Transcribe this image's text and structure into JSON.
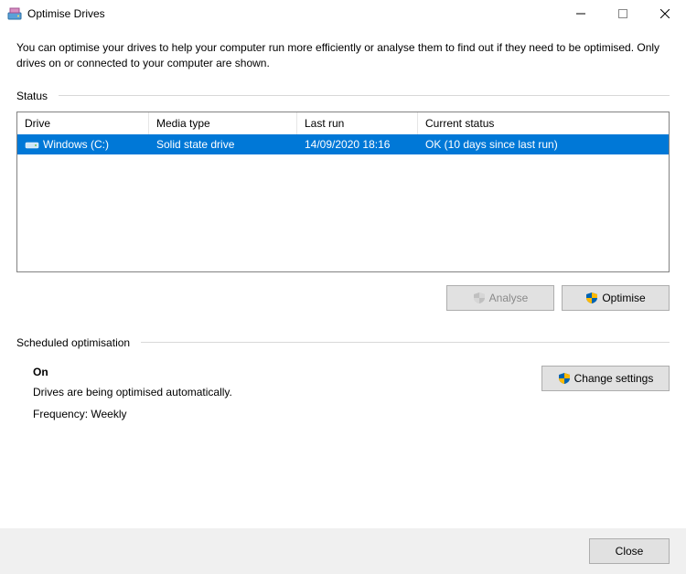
{
  "window": {
    "title": "Optimise Drives"
  },
  "intro": "You can optimise your drives to help your computer run more efficiently or analyse them to find out if they need to be optimised. Only drives on or connected to your computer are shown.",
  "status": {
    "label": "Status",
    "columns": {
      "drive": "Drive",
      "media": "Media type",
      "last": "Last run",
      "status": "Current status"
    },
    "rows": [
      {
        "drive": "Windows (C:)",
        "media": "Solid state drive",
        "last": "14/09/2020 18:16",
        "status": "OK (10 days since last run)"
      }
    ]
  },
  "actions": {
    "analyse": "Analyse",
    "optimise": "Optimise"
  },
  "scheduled": {
    "label": "Scheduled optimisation",
    "state": "On",
    "desc": "Drives are being optimised automatically.",
    "freq": "Frequency: Weekly",
    "change": "Change settings"
  },
  "footer": {
    "close": "Close"
  }
}
